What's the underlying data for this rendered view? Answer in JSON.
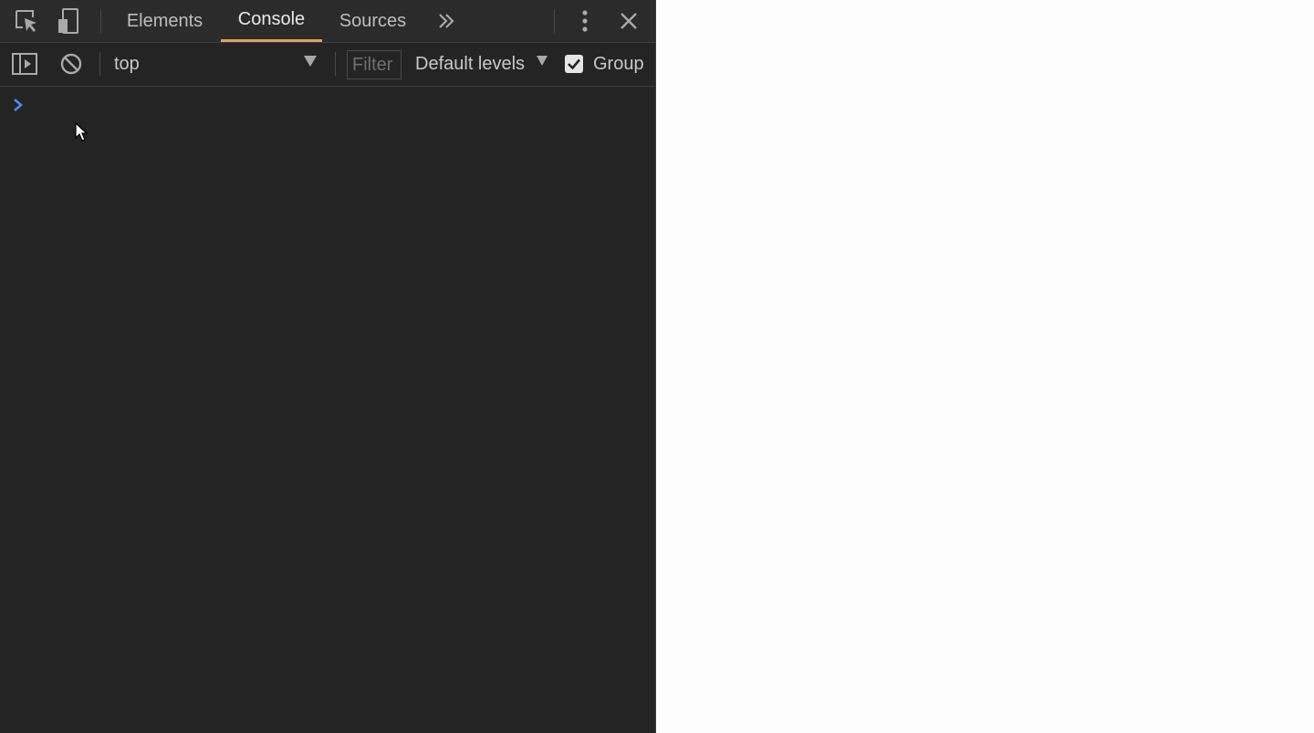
{
  "tabs": [
    {
      "label": "Elements",
      "active": false
    },
    {
      "label": "Console",
      "active": true
    },
    {
      "label": "Sources",
      "active": false
    }
  ],
  "icons": {
    "inspect": "inspect-element-icon",
    "device": "device-toolbar-icon",
    "more_tabs": "chevrons-right-icon",
    "menu": "vertical-dots-icon",
    "close": "close-icon",
    "sidebar": "sidebar-toggle-icon",
    "clear": "clear-console-icon",
    "prompt": "chevron-right-icon"
  },
  "toolbar": {
    "context": "top",
    "filter_placeholder": "Filter",
    "filter_value": "",
    "levels": "Default levels",
    "group_label": "Group",
    "group_checked": true
  },
  "colors": {
    "panel_bg": "#242424",
    "tabbar_bg": "#2b2b2b",
    "active_tab_underline": "#e0a060",
    "prompt": "#4a8cf0",
    "page_bg": "#fdfdfd"
  }
}
